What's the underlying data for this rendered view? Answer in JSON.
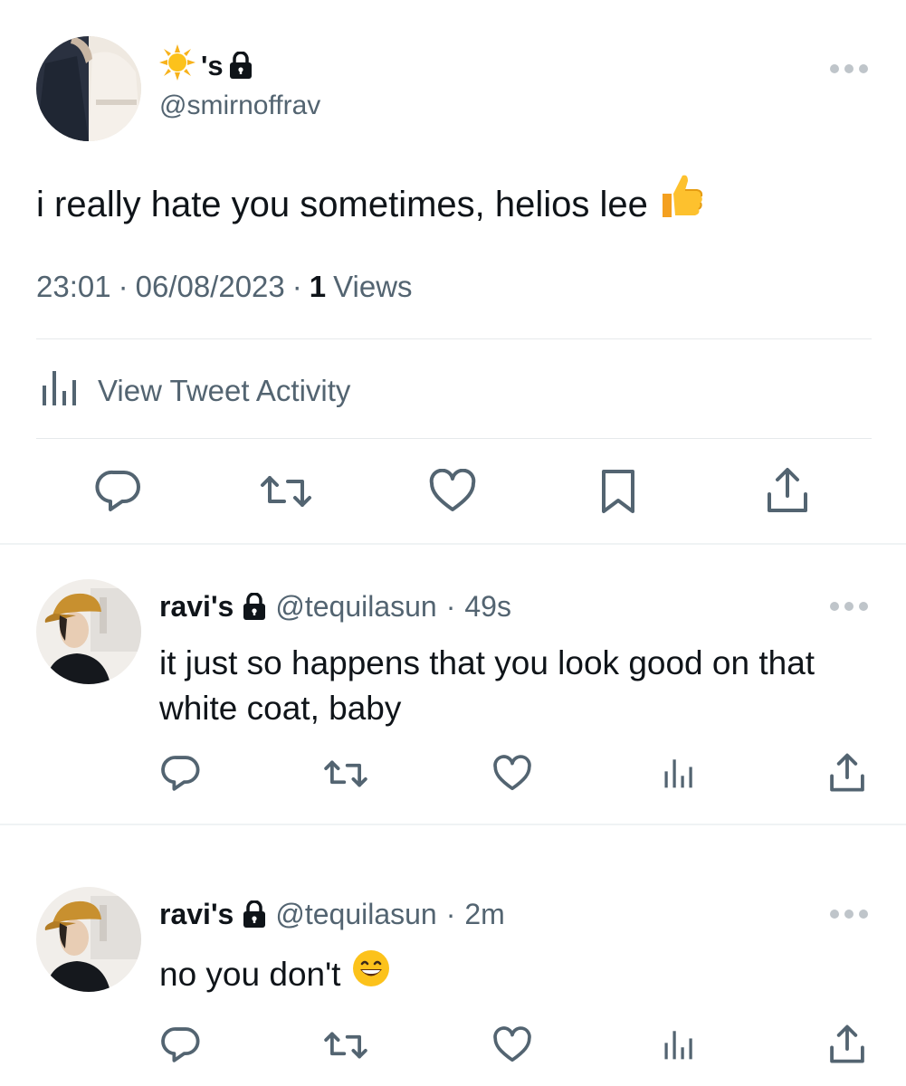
{
  "main_tweet": {
    "name_suffix": "'s",
    "handle": "@smirnoffrav",
    "text": "i really hate you sometimes, helios lee",
    "time": "23:01",
    "date": "06/08/2023",
    "views_count": "1",
    "views_label": "Views",
    "separator": "·",
    "activity_label": "View Tweet Activity"
  },
  "replies": [
    {
      "name": "ravi's",
      "handle": "@tequilasun",
      "separator": "·",
      "time": "49s",
      "text": "it just so happens that you look good on that white coat, baby"
    },
    {
      "name": "ravi's",
      "handle": "@tequilasun",
      "separator": "·",
      "time": "2m",
      "text": "no you don't"
    }
  ],
  "icons": {
    "name_emoji": "sun-icon",
    "lock": "lock-icon",
    "tweet_emoji": "thumbs-up-icon",
    "reply_emoji": "grinning-face-icon",
    "actions_main": [
      "reply-icon",
      "retweet-icon",
      "like-icon",
      "bookmark-icon",
      "share-icon"
    ],
    "actions_reply": [
      "reply-icon",
      "retweet-icon",
      "like-icon",
      "analytics-icon",
      "share-icon"
    ]
  },
  "colors": {
    "text": "#0f1419",
    "secondary": "#536471",
    "divider": "#eff3f4"
  }
}
